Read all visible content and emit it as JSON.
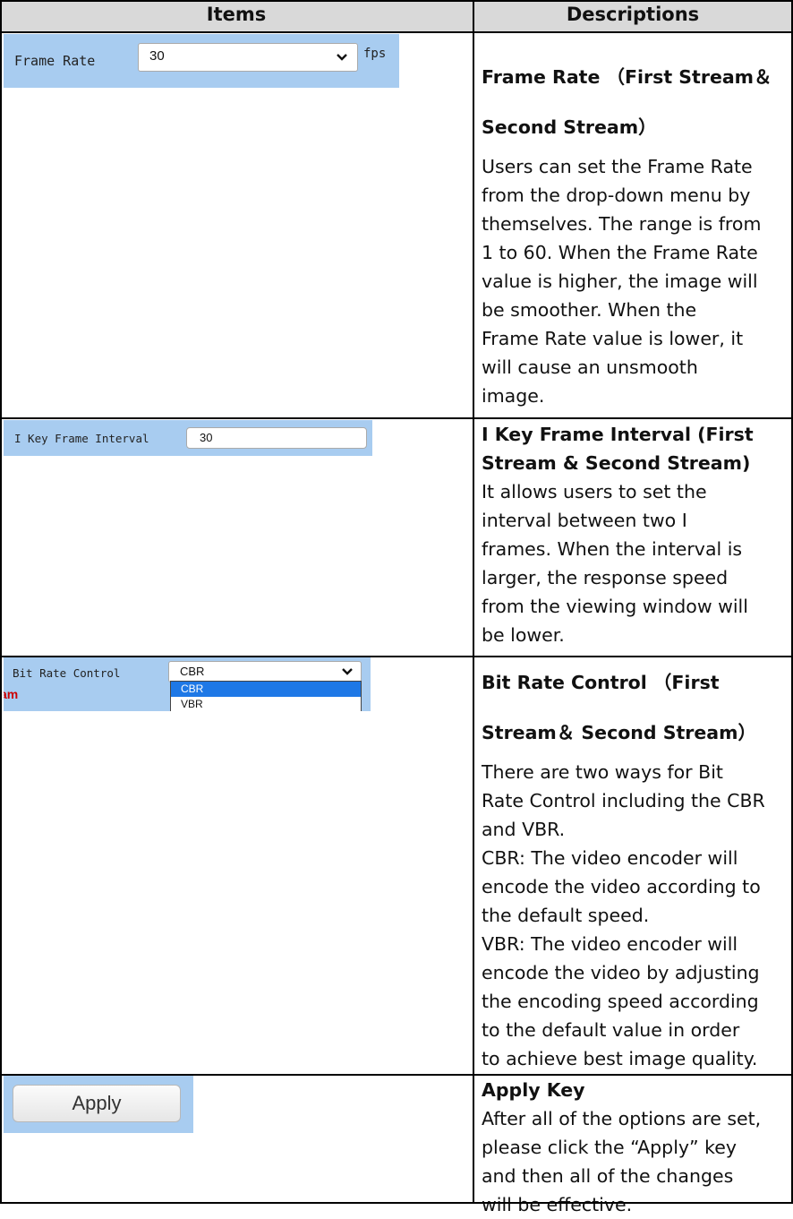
{
  "header": {
    "items_label": "Items",
    "descriptions_label": "Descriptions"
  },
  "frame_rate": {
    "screenshot": {
      "label": "Frame Rate",
      "value": "30",
      "unit": "fps"
    },
    "title": "Frame Rate （First Stream＆\nSecond Stream）",
    "description": "Users can set the Frame Rate\nfrom the drop-down menu by\nthemselves. The range is from\n1 to 60. When the Frame Rate\nvalue is higher, the image will\nbe smoother. When the\nFrame Rate value is lower, it\nwill cause an unsmooth\nimage."
  },
  "key_frame": {
    "screenshot": {
      "label": "I Key Frame Interval",
      "value": "30"
    },
    "title": "I Key Frame Interval (First\nStream & Second Stream)",
    "description": "It allows users to set the\ninterval between two I\nframes. When the interval is\nlarger, the response speed\nfrom the viewing window will\nbe lower."
  },
  "bit_rate": {
    "screenshot": {
      "label": "Bit Rate Control",
      "value": "CBR",
      "options": [
        "CBR",
        "VBR"
      ],
      "cut_text": "am"
    },
    "title": "Bit Rate Control （First\nStream＆ Second Stream）",
    "description": "There are two ways for Bit\nRate Control including the CBR\nand VBR.\nCBR: The video encoder will\nencode the video according to\nthe default speed.\nVBR: The video encoder will\nencode the video by adjusting\nthe encoding speed according\nto the default value in order\nto achieve best image quality."
  },
  "apply": {
    "screenshot": {
      "button_label": "Apply"
    },
    "title": "Apply Key",
    "description": "After all of the options are set,\nplease click the “Apply” key\nand then all of the changes\nwill be effective."
  },
  "colors": {
    "panel_bg": "#a8ccf0",
    "header_bg": "#d9d9d9",
    "dropdown_highlight": "#1e78e6",
    "cut_text": "#cc0000"
  }
}
